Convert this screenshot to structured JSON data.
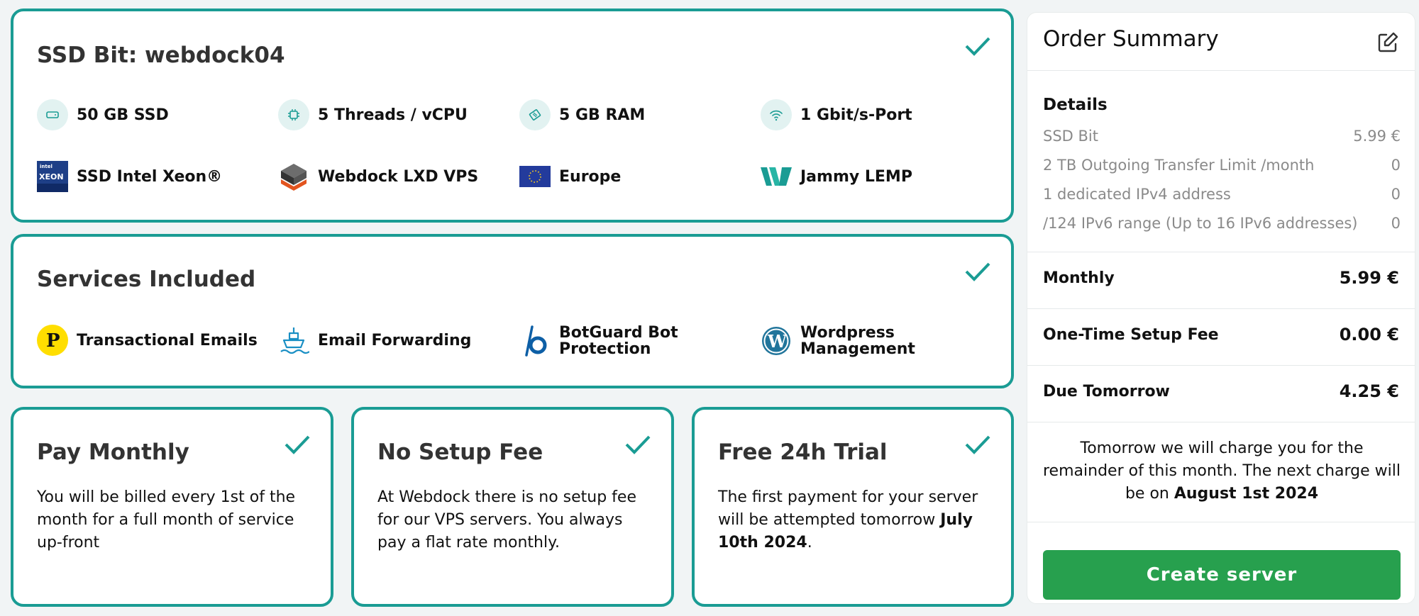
{
  "plan_card": {
    "title": "SSD Bit: webdock04",
    "specs": [
      {
        "icon": "disk-icon",
        "label": "50 GB SSD"
      },
      {
        "icon": "cpu-icon",
        "label": "5 Threads / vCPU"
      },
      {
        "icon": "ram-icon",
        "label": "5 GB RAM"
      },
      {
        "icon": "wifi-icon",
        "label": "1 Gbit/s-Port"
      },
      {
        "icon": "intel-xeon-logo",
        "label": "SSD Intel Xeon®"
      },
      {
        "icon": "lxd-logo",
        "label": "Webdock LXD VPS"
      },
      {
        "icon": "eu-flag-icon",
        "label": "Europe"
      },
      {
        "icon": "webdock-logo",
        "label": "Jammy LEMP"
      }
    ]
  },
  "services_card": {
    "title": "Services Included",
    "services": [
      {
        "icon": "postmark-logo",
        "label": "Transactional Emails"
      },
      {
        "icon": "email-ship-icon",
        "label": "Email Forwarding"
      },
      {
        "icon": "botguard-logo",
        "label_line1": "BotGuard Bot",
        "label_line2": "Protection"
      },
      {
        "icon": "wordpress-logo",
        "label_line1": "Wordpress",
        "label_line2": "Management"
      }
    ]
  },
  "info_cards": [
    {
      "title": "Pay Monthly",
      "text": "You will be billed every 1st of the month for a full month of service up-front"
    },
    {
      "title": "No Setup Fee",
      "text": "At Webdock there is no setup fee for our VPS servers. You always pay a flat rate monthly."
    },
    {
      "title": "Free 24h Trial",
      "text_before": "The first payment for your server will be attempted tomorrow",
      "text_bold": "July 10th 2024",
      "text_after": "."
    }
  ],
  "summary": {
    "title": "Order Summary",
    "details_heading": "Details",
    "details": [
      {
        "label": "SSD Bit",
        "value": "5.99 €"
      },
      {
        "label": "2 TB Outgoing Transfer Limit /month",
        "value": "0"
      },
      {
        "label": "1 dedicated IPv4 address",
        "value": "0"
      },
      {
        "label": "/124 IPv6 range (Up to 16 IPv6 addresses)",
        "value": "0"
      }
    ],
    "monthly_label": "Monthly",
    "monthly_value": "5.99 €",
    "setup_label": "One-Time Setup Fee",
    "setup_value": "0.00 €",
    "due_label": "Due Tomorrow",
    "due_value": "4.25 €",
    "note_text": "Tomorrow we will charge you for the remainder of this month. The next charge will be on",
    "note_bold": "August 1st 2024",
    "create_button": "Create server"
  },
  "colors": {
    "accent": "#1a9c94",
    "button": "#27a04e"
  }
}
